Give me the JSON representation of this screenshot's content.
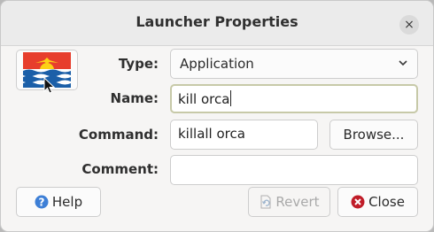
{
  "window": {
    "title": "Launcher Properties",
    "close_glyph": "×"
  },
  "icon": {
    "name": "kiribati-flag-icon"
  },
  "form": {
    "type_label": "Type:",
    "type_value": "Application",
    "name_label": "Name:",
    "name_value": "kill orca",
    "command_label": "Command:",
    "command_value": "killall orca",
    "browse_label": "Browse...",
    "comment_label": "Comment:",
    "comment_value": ""
  },
  "buttons": {
    "help_label": "Help",
    "revert_label": "Revert",
    "close_label": "Close"
  },
  "colors": {
    "help_icon": "#3d7fd6",
    "close_icon": "#c01c28"
  }
}
